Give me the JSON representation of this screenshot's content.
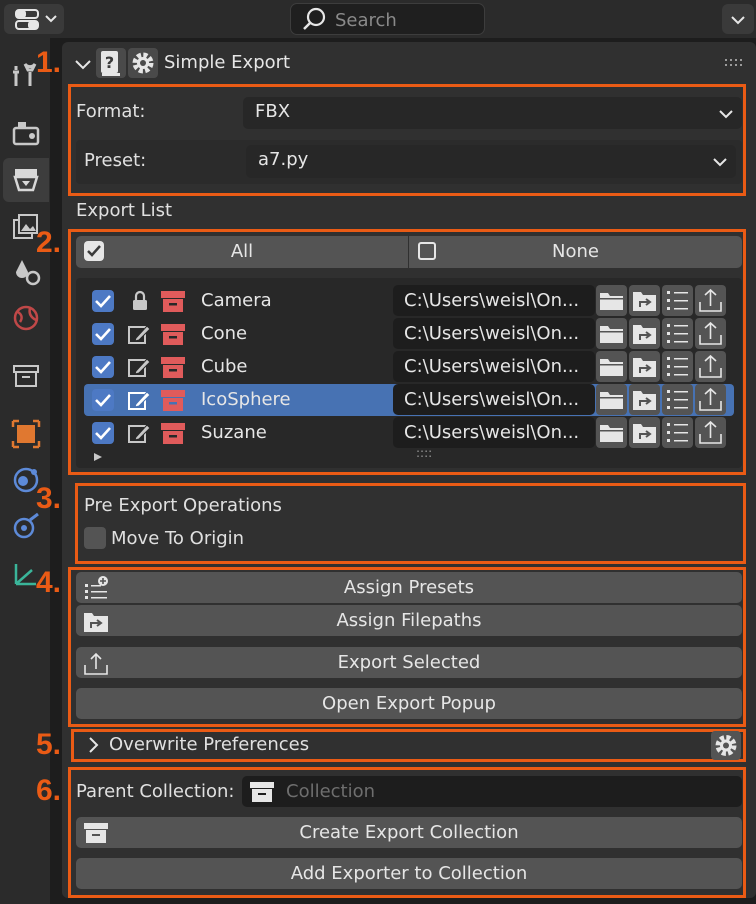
{
  "search": {
    "placeholder": "Search"
  },
  "annotations": [
    "1.",
    "2.",
    "3.",
    "4.",
    "5.",
    "6."
  ],
  "panel": {
    "title": "Simple Export"
  },
  "section1": {
    "format_label": "Format:",
    "format_value": "FBX",
    "preset_label": "Preset:",
    "preset_value": "a7.py"
  },
  "export_list": {
    "title": "Export List",
    "all_label": "All",
    "none_label": "None",
    "items": [
      {
        "name": "Camera",
        "path": "C:\\Users\\weisl\\On...",
        "checked": true,
        "locked": true,
        "selected": false
      },
      {
        "name": "Cone",
        "path": "C:\\Users\\weisl\\On...",
        "checked": true,
        "locked": false,
        "selected": false
      },
      {
        "name": "Cube",
        "path": "C:\\Users\\weisl\\On...",
        "checked": true,
        "locked": false,
        "selected": false
      },
      {
        "name": "IcoSphere",
        "path": "C:\\Users\\weisl\\On...",
        "checked": true,
        "locked": false,
        "selected": true
      },
      {
        "name": "Suzane",
        "path": "C:\\Users\\weisl\\On...",
        "checked": true,
        "locked": false,
        "selected": false
      }
    ],
    "grip": "::::"
  },
  "pre_export": {
    "title": "Pre Export Operations",
    "move_to_origin": "Move To Origin"
  },
  "actions": {
    "assign_presets": "Assign Presets",
    "assign_filepaths": "Assign Filepaths",
    "export_selected": "Export Selected",
    "open_popup": "Open Export Popup"
  },
  "overwrite": {
    "label": "Overwrite Preferences"
  },
  "collection": {
    "parent_label": "Parent Collection:",
    "placeholder": "Collection",
    "create": "Create Export Collection",
    "add": "Add Exporter to Collection"
  },
  "colors": {
    "accent": "#ea5b15",
    "selected_row": "#4772b3",
    "checkbox": "#4d79c4",
    "collection_icon": "#e05b5b"
  }
}
